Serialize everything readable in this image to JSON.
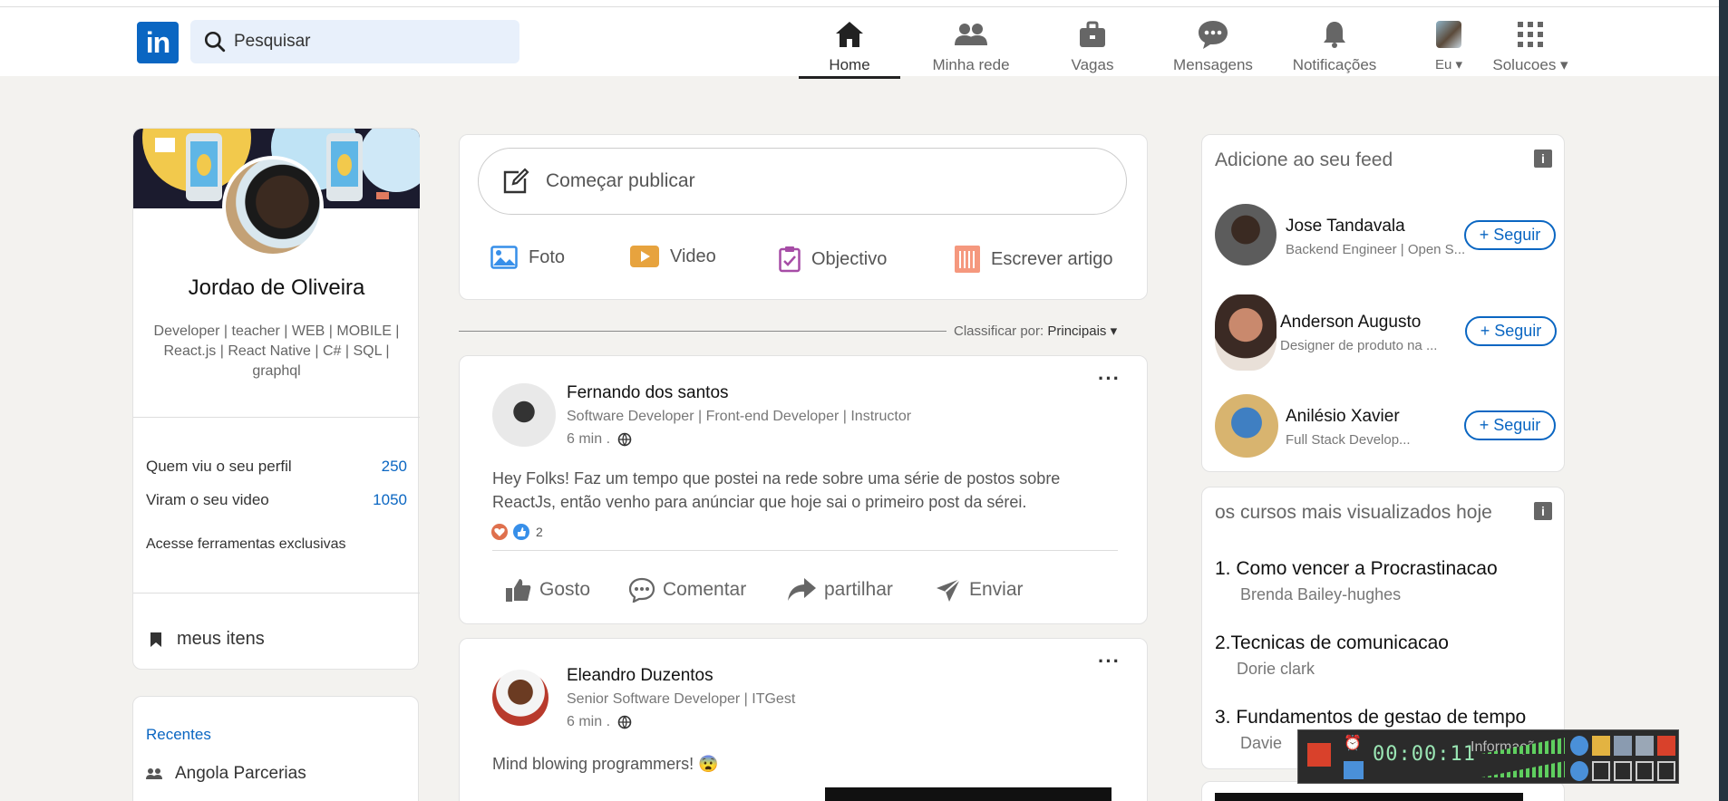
{
  "header": {
    "logo": "in",
    "search_placeholder": "Pesquisar",
    "nav": [
      {
        "label": "Home",
        "icon": "home-icon"
      },
      {
        "label": "Minha rede",
        "icon": "network-icon"
      },
      {
        "label": "Vagas",
        "icon": "briefcase-icon"
      },
      {
        "label": "Mensagens",
        "icon": "messages-icon"
      },
      {
        "label": "Notificações",
        "icon": "bell-icon"
      },
      {
        "label": "Eu ▾",
        "icon": "avatar"
      },
      {
        "label": "Solucoes ▾",
        "icon": "grid-icon"
      }
    ]
  },
  "profile": {
    "name": "Jordao de Oliveira",
    "headline": "Developer | teacher | WEB | MOBILE | React.js | React Native | C# | SQL | graphql",
    "stats": [
      {
        "label": "Quem viu o seu perfil",
        "value": "250"
      },
      {
        "label": "Viram o seu video",
        "value": "1050"
      }
    ],
    "tools": "Acesse ferramentas exclusivas",
    "my_items": "meus itens"
  },
  "recent": {
    "title": "Recentes",
    "items": [
      "Angola Parcerias"
    ]
  },
  "composer": {
    "placeholder": "Começar publicar",
    "actions": [
      {
        "label": "Foto",
        "icon": "photo-icon",
        "color": "#378fe9"
      },
      {
        "label": "Video",
        "icon": "video-icon",
        "color": "#e7a33e"
      },
      {
        "label": "Objectivo",
        "icon": "clipboard-icon",
        "color": "#a64ca6"
      },
      {
        "label": "Escrever artigo",
        "icon": "article-icon",
        "color": "#f5987e"
      }
    ]
  },
  "sort": {
    "label": "Classificar por:",
    "value": "Principais ▾"
  },
  "posts": [
    {
      "author": "Fernando dos santos",
      "title": "Software Developer | Front-end Developer | Instructor",
      "time": "6 min .",
      "text": "Hey Folks! Faz um tempo que postei na rede sobre uma série de postos sobre ReactJs, então venho para anúnciar que hoje sai o primeiro post da sérei.",
      "reactions": "2"
    },
    {
      "author": "Eleandro Duzentos",
      "title": "Senior Software Developer | ITGest",
      "time": "6 min .",
      "text": "Mind blowing programmers! 😨"
    }
  ],
  "post_actions": [
    "Gosto",
    "Comentar",
    "partilhar",
    "Enviar"
  ],
  "feed": {
    "title": "Adicione ao seu feed",
    "follow_label": "+ Seguir",
    "people": [
      {
        "name": "Jose Tandavala",
        "sub": "Backend Engineer | Open S..."
      },
      {
        "name": "Anderson Augusto",
        "sub": "Designer de produto na ..."
      },
      {
        "name": "Anilésio Xavier",
        "sub": "Full Stack Develop..."
      }
    ]
  },
  "courses": {
    "title": "os cursos mais visualizados hoje",
    "items": [
      {
        "n": "1.",
        "title": "Como vencer a Procrastinacao",
        "author": "Brenda Bailey-hughes"
      },
      {
        "n": "2.",
        "title": "Tecnicas de comunicacao",
        "author": "Dorie clark"
      },
      {
        "n": "3.",
        "title": "Fundamentos de gestao de tempo",
        "author": "Davie"
      }
    ]
  },
  "overlay": {
    "counter": "00:00:11",
    "text": "Informações"
  }
}
